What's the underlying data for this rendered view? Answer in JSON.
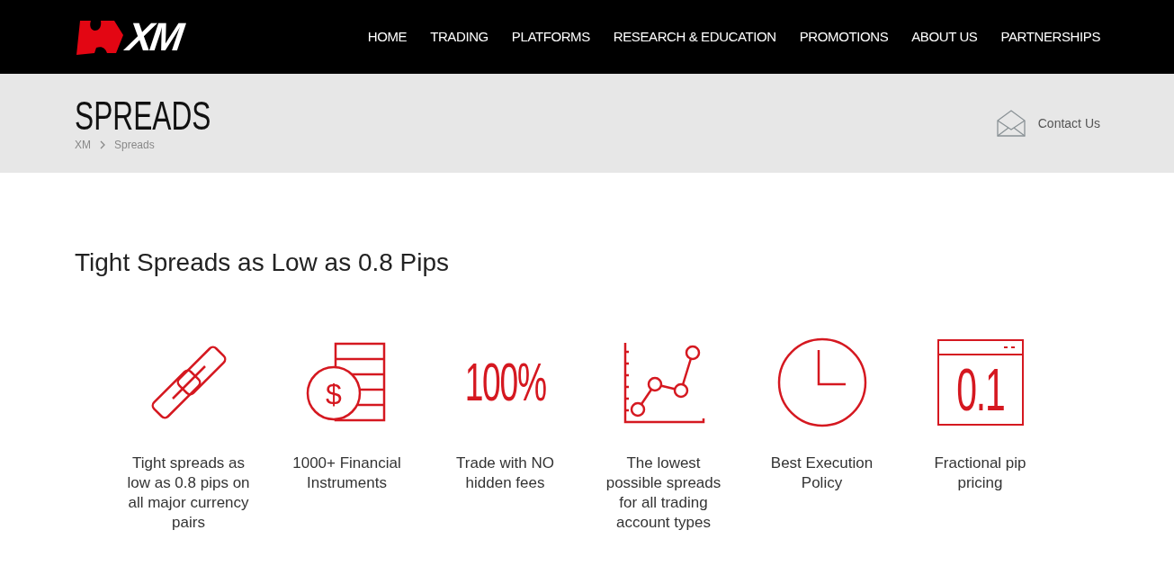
{
  "header": {
    "logo_text": "XM",
    "nav": [
      {
        "label": "HOME",
        "selected": false
      },
      {
        "label": "TRADING",
        "selected": false
      },
      {
        "label": "PLATFORMS",
        "selected": false
      },
      {
        "label": "RESEARCH & EDUCATION",
        "selected": false
      },
      {
        "label": "PROMOTIONS",
        "selected": false
      },
      {
        "label": "ABOUT US",
        "selected": false
      },
      {
        "label": "PARTNERSHIPS",
        "selected": false
      }
    ]
  },
  "banner": {
    "title": "SPREADS",
    "breadcrumb": [
      "XM",
      "Spreads"
    ],
    "contact": "Contact Us"
  },
  "heading": "Tight Spreads as Low as 0.8 Pips",
  "features": [
    {
      "kind": "link",
      "caption": "Tight spreads as low as 0.8 pips on all major currency pairs"
    },
    {
      "kind": "coins",
      "glyph": "$",
      "caption": "1000+ Financial Instruments"
    },
    {
      "kind": "percent",
      "glyph": "100%",
      "caption": "Trade with NO hidden fees"
    },
    {
      "kind": "chart",
      "caption": "The lowest possible spreads for all trading account types"
    },
    {
      "kind": "clock",
      "caption": "Best Execution Policy"
    },
    {
      "kind": "window",
      "glyph": "0.1",
      "caption": "Fractional pip pricing"
    }
  ]
}
